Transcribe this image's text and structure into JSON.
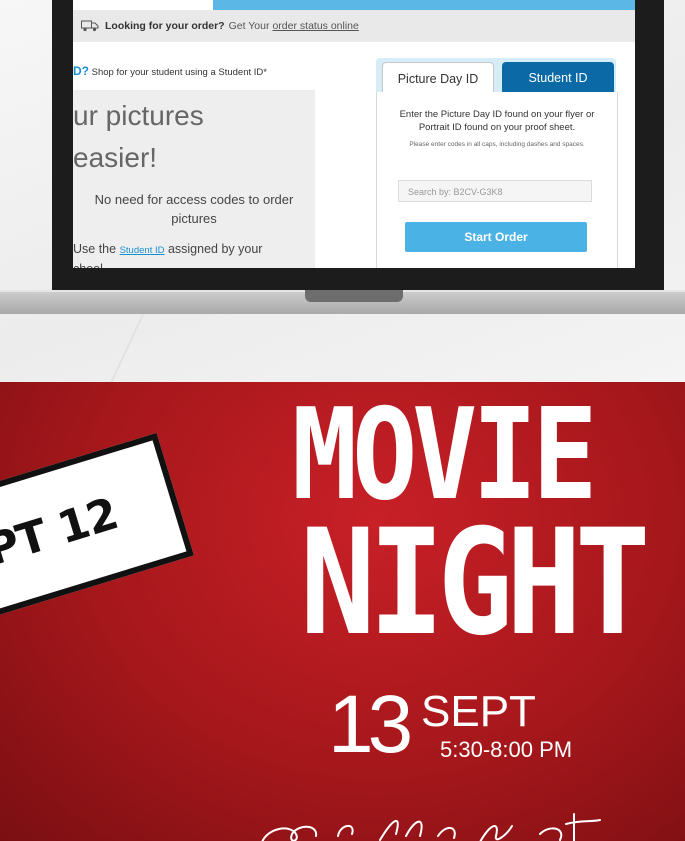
{
  "laptop": {
    "notice": {
      "bold": "Looking for your order?",
      "text": "Get Your",
      "link": "order status online"
    },
    "left": {
      "shop_prefix": "D?",
      "shop_text": "Shop for your student using a Student ID*",
      "headline_1": "ur pictures",
      "headline_2": "easier!",
      "no_codes": "No need for access codes to order pictures",
      "use_prefix": "Use the",
      "use_link": "Student ID",
      "use_suffix": "assigned by your",
      "use_line2": "chool"
    },
    "tabs": {
      "picture_day": "Picture Day ID",
      "student_id": "Student ID"
    },
    "form": {
      "instructions": "Enter the Picture Day ID found on your flyer or Portrait ID found on your proof sheet.",
      "note": "Please enter codes in all caps, including dashes and spaces.",
      "search_placeholder": "Search by: B2CV-G3K8",
      "start_label": "Start Order"
    }
  },
  "poster": {
    "sign_text": "PT 12",
    "title_1": "MOVIE",
    "title_2": "NIGHT",
    "date_day": "13",
    "date_month": "SEPT",
    "time": "5:30-8:00 PM"
  },
  "colors": {
    "poster_red": "#b81a20",
    "link_blue": "#1a8fd0",
    "tab_blue": "#0b6aa6",
    "button_blue": "#4bb2e6"
  }
}
